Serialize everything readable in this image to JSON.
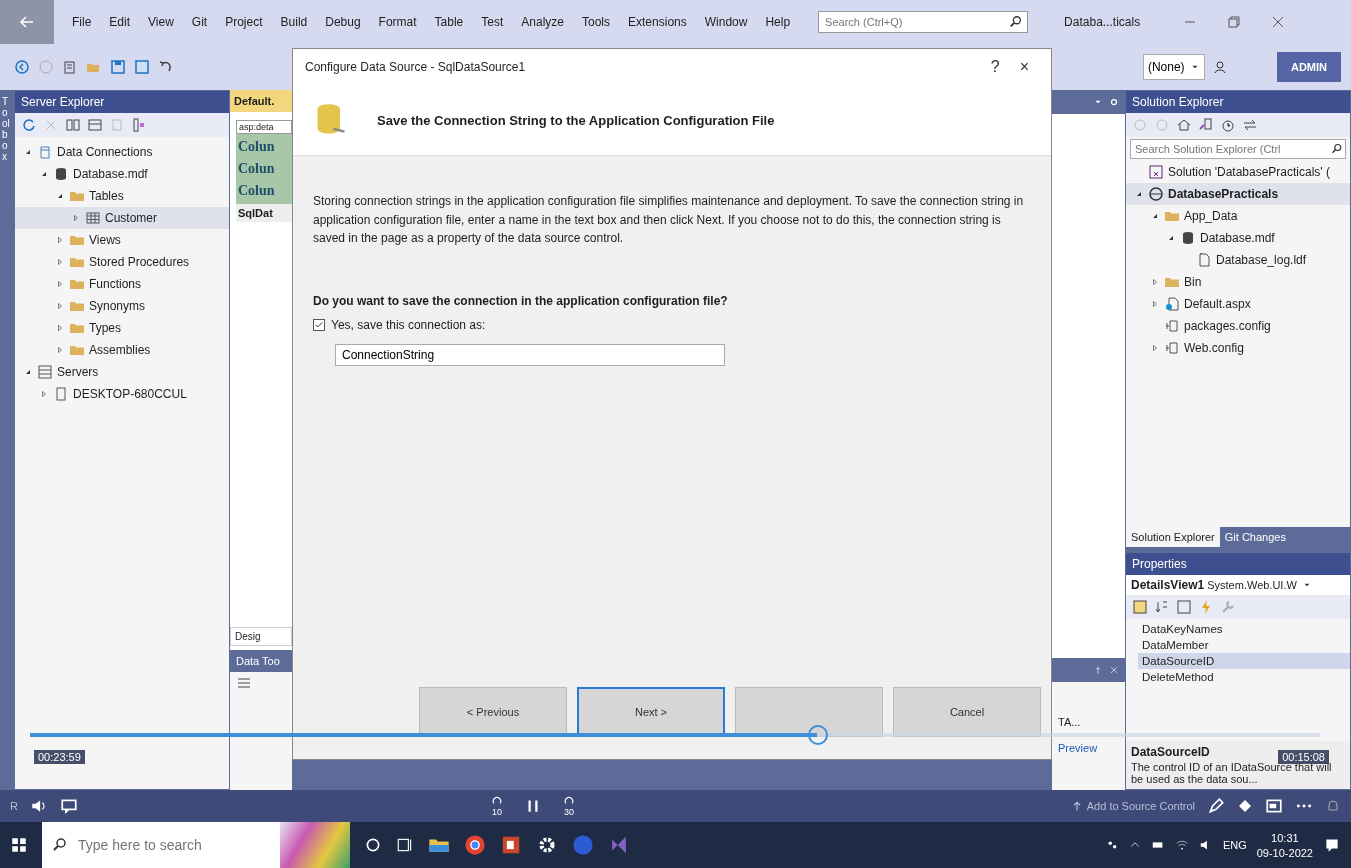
{
  "menu_bar": {
    "items": [
      "File",
      "Edit",
      "View",
      "Git",
      "Project",
      "Build",
      "Debug",
      "Format",
      "Table",
      "Test",
      "Analyze",
      "Tools",
      "Extensions",
      "Window",
      "Help"
    ],
    "search": {
      "placeholder": "Search (Ctrl+Q)"
    },
    "solution_name": "Databa...ticals"
  },
  "toolbar": {
    "dropdown": "(None)",
    "account": "ADMIN"
  },
  "toolbox_tab": "Toolbox",
  "server_explorer": {
    "title": "Server Explorer",
    "tree": [
      {
        "label": "Data Connections",
        "kind": "connections",
        "expanded": true,
        "selected": false,
        "children": [
          {
            "label": "Database.mdf",
            "kind": "database",
            "expanded": true,
            "selected": false,
            "children": [
              {
                "label": "Tables",
                "kind": "folder",
                "expanded": true,
                "selected": false,
                "children": [
                  {
                    "label": "Customer",
                    "kind": "table",
                    "expanded": false,
                    "selected": true
                  }
                ]
              },
              {
                "label": "Views",
                "kind": "folder",
                "expanded": false,
                "selected": false
              },
              {
                "label": "Stored Procedures",
                "kind": "folder",
                "expanded": false,
                "selected": false
              },
              {
                "label": "Functions",
                "kind": "folder",
                "expanded": false,
                "selected": false
              },
              {
                "label": "Synonyms",
                "kind": "folder",
                "expanded": false,
                "selected": false
              },
              {
                "label": "Types",
                "kind": "folder",
                "expanded": false,
                "selected": false
              },
              {
                "label": "Assemblies",
                "kind": "folder",
                "expanded": false,
                "selected": false
              }
            ]
          }
        ]
      },
      {
        "label": "Servers",
        "kind": "server",
        "expanded": true,
        "selected": false,
        "children": [
          {
            "label": "DESKTOP-680CCUL",
            "kind": "computer",
            "expanded": false,
            "selected": false
          }
        ]
      }
    ]
  },
  "editor": {
    "tab": "Default.",
    "tag": "asp:deta",
    "columns": [
      "Colun",
      "Colun",
      "Colun"
    ],
    "control": "SqlDat",
    "design_tab": "Desig"
  },
  "data_tools": {
    "title": "Data Too",
    "cell": "TA...",
    "link": "Preview"
  },
  "dialog": {
    "title": "Configure Data Source - SqlDataSource1",
    "help": "?",
    "close": "×",
    "heading": "Save the Connection String to the Application Configuration File",
    "description": "Storing connection strings in the application configuration file simplifies maintenance and deployment. To save the connection string in application configuration file, enter a name in the text box and then click Next. If you choose not to do this, the connection string is saved in the page as a property of the data source control.",
    "question": "Do you want to save the connection in the application configuration file?",
    "save_option": {
      "label": "Yes, save this connection as:",
      "checked": true
    },
    "connection_name": "ConnectionString",
    "buttons": [
      {
        "label": "< Previous",
        "focused": false
      },
      {
        "label": "Next >",
        "focused": true
      },
      {
        "focused": false
      },
      {
        "label": "Cancel",
        "focused": false
      }
    ]
  },
  "solution_explorer": {
    "title": "Solution Explorer",
    "search": {
      "placeholder": "Search Solution Explorer (Ctrl"
    },
    "tree": [
      {
        "label": "Solution 'DatabasePracticals' (",
        "kind": "solution",
        "selected": false
      },
      {
        "label": "DatabasePracticals",
        "kind": "project",
        "expanded": true,
        "selected": true,
        "children": [
          {
            "label": "App_Data",
            "kind": "folder",
            "expanded": true,
            "selected": false,
            "children": [
              {
                "label": "Database.mdf",
                "kind": "database",
                "expanded": true,
                "selected": false,
                "children": [
                  {
                    "label": "Database_log.ldf",
                    "kind": "file",
                    "selected": false
                  }
                ]
              }
            ]
          },
          {
            "label": "Bin",
            "kind": "folder",
            "expanded": false,
            "selected": false
          },
          {
            "label": "Default.aspx",
            "kind": "page",
            "expanded": false,
            "selected": false
          },
          {
            "label": "packages.config",
            "kind": "config",
            "selected": false
          },
          {
            "label": "Web.config",
            "kind": "config",
            "expanded": false,
            "selected": false
          }
        ]
      }
    ],
    "tabs": [
      {
        "label": "Solution Explorer",
        "selected": true
      },
      {
        "label": "Git Changes",
        "selected": false
      }
    ]
  },
  "properties": {
    "title": "Properties",
    "object": "DetailsView1",
    "type": "System.Web.UI.W",
    "items": [
      {
        "label": "DataKeyNames",
        "selected": false
      },
      {
        "label": "DataMember",
        "selected": false
      },
      {
        "label": "DataSourceID",
        "selected": true
      },
      {
        "label": "DeleteMethod",
        "selected": false
      }
    ],
    "description_title": "DataSourceID",
    "description": "The control ID of an IDataSource that will be used as the data sou..."
  },
  "video_player": {
    "elapsed": "00:23:59",
    "remaining": "00:15:08",
    "progress": {
      "level": 0.61
    },
    "rewind": "10",
    "forward": "30"
  },
  "status_bar": {
    "state": "R",
    "source_control": "Add to Source Control"
  },
  "taskbar": {
    "search": {
      "placeholder": "Type here to search"
    },
    "language": "ENG",
    "time": "10:31",
    "date": "09-10-2022"
  }
}
